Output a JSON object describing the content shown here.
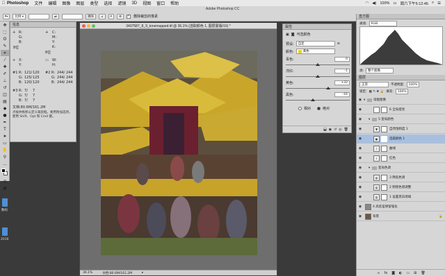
{
  "menubar": {
    "app": "Photoshop",
    "items": [
      "文件",
      "编辑",
      "图像",
      "图层",
      "类型",
      "选择",
      "滤镜",
      "3D",
      "视图",
      "窗口",
      "帮助"
    ],
    "battery": "100%",
    "clock": "周六下午5:12:45"
  },
  "options_bar": {
    "window_title": "Adobe Photoshop CC",
    "sample_label": "比例",
    "clear_label": "清除",
    "delete_cropped_label": "删除裁剪的像素"
  },
  "info_panel": {
    "tab": "信息",
    "r_label": "R:",
    "g_label": "G:",
    "b_label": "B:",
    "c_label": "C:",
    "m_label": "M:",
    "y_label": "Y:",
    "k_label": "K:",
    "bits_left": "8位",
    "bits_right": "8位",
    "x_label": "X:",
    "y_coord_label": "Y:",
    "w_label": "W:",
    "h_label": "H:",
    "sample1": "#1",
    "sample1_r": "121/",
    "sample1_r2": "120",
    "sample1_g": "125/",
    "sample1_g2": "125",
    "sample1_b": "120/",
    "sample1_b2": "120",
    "sample2": "#2",
    "sample2_r": "244/",
    "sample2_r2": "244",
    "sample2_g": "244/",
    "sample2_g2": "244",
    "sample2_b": "244/",
    "sample2_b2": "244",
    "sample3": "#3",
    "sample3_r": "7/",
    "sample3_r2": "7",
    "sample3_g": "7/",
    "sample3_g2": "7",
    "sample3_b": "7/",
    "sample3_b2": "7",
    "doc_size": "文档:80.6M/161.2M",
    "hint": "点按并拖移以定义裁剪框。要用附加选项，使用 Shift、Opt 和 Cmd 键。"
  },
  "desktop": {
    "label1": "数码",
    "label2": "2016"
  },
  "document": {
    "title": "3407587_8_9_tonemapped.tif @ 36.1% (选取颜色 1, 图层蒙版/16) *",
    "zoom": "36.1%",
    "doc_size": "文档:80.6M/161.2M"
  },
  "properties": {
    "tab": "属性",
    "subtitle": "可选颜色",
    "preset_label": "预设:",
    "preset_value": "自定",
    "colors_label": "颜色:",
    "colors_value": "黄色",
    "sliders": [
      {
        "label": "青色:",
        "value": "0",
        "unit": "%",
        "pos": 0.5
      },
      {
        "label": "洋红:",
        "value": "-1",
        "unit": "%",
        "pos": 0.495
      },
      {
        "label": "黄色:",
        "value": "+32",
        "unit": "%",
        "pos": 0.66
      },
      {
        "label": "黑色:",
        "value": "-16",
        "unit": "%",
        "pos": 0.42
      }
    ],
    "mode_relative": "相对",
    "mode_absolute": "绝对"
  },
  "histogram": {
    "tab": "直方图",
    "channel_label": "通道:",
    "channel_value": "RGB",
    "source_label": "源:",
    "source_value": "整个图像"
  },
  "layers": {
    "tab": "图层",
    "blend_mode": "正常",
    "opacity_label": "不透明度:",
    "opacity_value": "100%",
    "lock_label": "锁定:",
    "fill_label": "填充:",
    "fill_value": "100%",
    "items": [
      {
        "name": "母版图像",
        "kind": "group"
      },
      {
        "name": "6 全局提亮",
        "kind": "mask"
      },
      {
        "name": "5 变局颜色",
        "kind": "group"
      },
      {
        "name": "自然饱和度 1",
        "kind": "adjustment"
      },
      {
        "name": "选取颜色 1",
        "kind": "adjustment",
        "selected": true
      },
      {
        "name": "曲线",
        "kind": "adjustment"
      },
      {
        "name": "红色",
        "kind": "adjustment"
      },
      {
        "name": "变局色调",
        "kind": "group"
      },
      {
        "name": "3 降低色调",
        "kind": "adjustment"
      },
      {
        "name": "2 明暗色调调整",
        "kind": "adjustment"
      },
      {
        "name": "1 设置黑白场域",
        "kind": "adjustment"
      },
      {
        "name": "4 高反差保留强化",
        "kind": "layer"
      },
      {
        "name": "背景",
        "kind": "image"
      }
    ]
  }
}
